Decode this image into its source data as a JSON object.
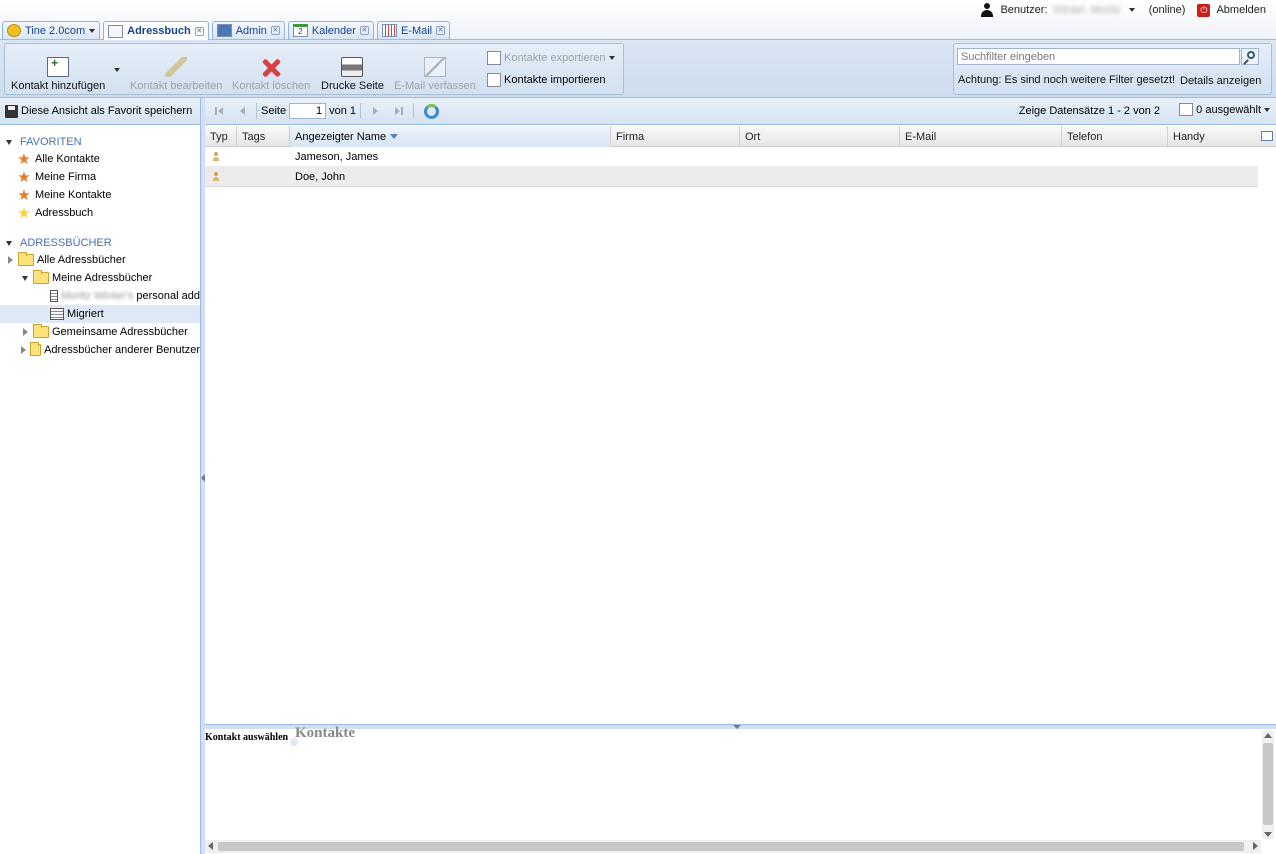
{
  "userbar": {
    "user_label": "Benutzer:",
    "user_name": "Winter, Moritz",
    "status": "(online)",
    "logout": "Abmelden"
  },
  "tabs": [
    {
      "label": "Tine 2.0com",
      "icon": "tine-logo-icon"
    },
    {
      "label": "Adressbuch",
      "icon": "addressbook-icon",
      "active": true
    },
    {
      "label": "Admin",
      "icon": "admin-icon"
    },
    {
      "label": "Kalender",
      "icon": "calendar-icon",
      "day": "2"
    },
    {
      "label": "E-Mail",
      "icon": "email-icon"
    }
  ],
  "toolbar": {
    "add_contact": "Kontakt hinzufügen",
    "edit_contact": "Kontakt bearbeiten",
    "delete_contact": "Kontakt löschen",
    "print_page": "Drucke Seite",
    "compose_mail": "E-Mail verfassen",
    "export_contacts": "Kontakte exportieren",
    "import_contacts": "Kontakte importieren"
  },
  "filter": {
    "placeholder": "Suchfilter eingeben",
    "warning": "Achtung: Es sind noch weitere Filter gesetzt!",
    "details": "Details anzeigen"
  },
  "sidebar": {
    "save_favorite": "Diese Ansicht als Favorit speichern",
    "favorites_header": "FAVORITEN",
    "favorites": [
      {
        "label": "Alle Kontakte",
        "icon": "star-orange-icon"
      },
      {
        "label": "Meine Firma",
        "icon": "star-orange-icon"
      },
      {
        "label": "Meine Kontakte",
        "icon": "star-orange-icon"
      },
      {
        "label": "Adressbuch",
        "icon": "star-yellow-icon"
      }
    ],
    "books_header": "ADRESSBÜCHER",
    "books": {
      "all": "Alle Adressbücher",
      "mine": "Meine Adressbücher",
      "personal_owner": "Moritz Winter's",
      "personal_suffix": "personal add",
      "migrated": "Migriert",
      "shared": "Gemeinsame Adressbücher",
      "others": "Adressbücher anderer Benutzer"
    }
  },
  "paging": {
    "page_label": "Seite",
    "page_value": "1",
    "of_label": "von 1",
    "records": "Zeige Datensätze 1 - 2 von 2",
    "selected": "0 ausgewählt"
  },
  "grid": {
    "columns": [
      "Typ",
      "Tags",
      "Angezeigter Name",
      "Firma",
      "Ort",
      "E-Mail",
      "Telefon",
      "Handy"
    ],
    "rows": [
      {
        "name": "Jameson, James"
      },
      {
        "name": "Doe, John"
      }
    ]
  },
  "detail": {
    "label": "Kontakt auswählen",
    "title": "Kontakte"
  }
}
